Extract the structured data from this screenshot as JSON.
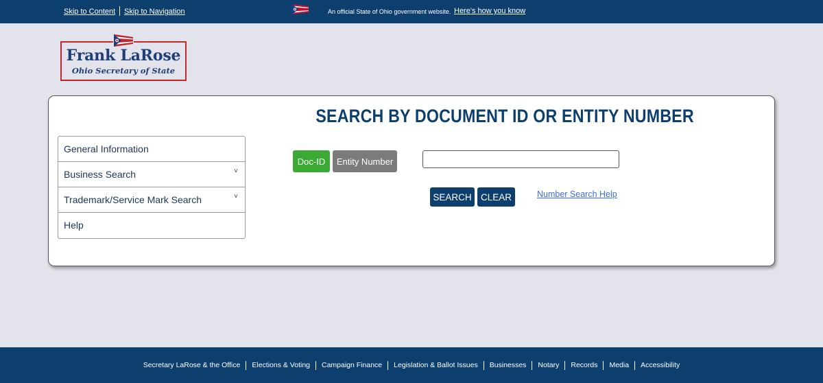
{
  "topbar": {
    "skip_content": "Skip to Content",
    "skip_navigation": "Skip to Navigation",
    "official_text": "An official State of Ohio government website.",
    "how_know": "Here's how you know"
  },
  "logo": {
    "name": "Frank LaRose",
    "subtitle": "Ohio Secretary of State"
  },
  "main": {
    "title": "SEARCH BY DOCUMENT ID OR ENTITY NUMBER",
    "buttons": {
      "doc_id": "Doc-ID",
      "entity_number": "Entity Number",
      "search": "SEARCH",
      "clear": "CLEAR"
    },
    "search_value": "",
    "help_link": "Number Search Help"
  },
  "sidebar": {
    "items": [
      {
        "label": "General Information"
      },
      {
        "label": "Business Search"
      },
      {
        "label": "Trademark/Service Mark Search"
      },
      {
        "label": "Help"
      }
    ]
  },
  "footer": {
    "links": [
      {
        "label": "Secretary LaRose & the Office"
      },
      {
        "label": "Elections & Voting"
      },
      {
        "label": "Campaign Finance"
      },
      {
        "label": "Legislation & Ballot Issues"
      },
      {
        "label": "Businesses"
      },
      {
        "label": "Notary"
      },
      {
        "label": "Records"
      },
      {
        "label": "Media"
      },
      {
        "label": "Accessibility"
      }
    ]
  },
  "colors": {
    "navy": "#0c3f6e",
    "active_green": "#3aaa35",
    "inactive_gray": "#7b7b7b",
    "logo_red": "#c1272d",
    "link_blue": "#3a6fd8"
  },
  "icons": [
    "ohio-flag-icon",
    "chevron-down-icon"
  ]
}
